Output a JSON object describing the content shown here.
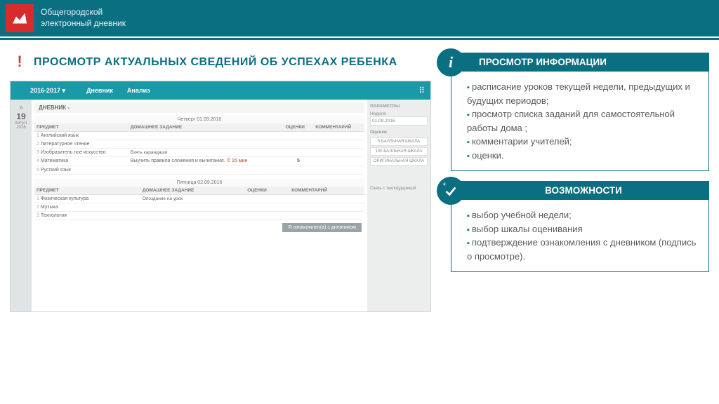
{
  "header": {
    "line1": "Общегородской",
    "line2": "электронный дневник"
  },
  "title": "ПРОСМОТР АКТУАЛЬНЫХ СВЕДЕНИЙ ОБ УСПЕХАХ РЕБЕНКА",
  "screenshot": {
    "year": "2016-2017 ▾",
    "tab1": "Дневник",
    "tab2": "Анализ",
    "dayNum": "19",
    "dayMonth": "Август",
    "dayYear": "2016",
    "diaryTitle": "ДНЕВНИК -",
    "hdr_day1": "Четверг  01.09.2016",
    "hdr_day2": "Пятница  02.09.2016",
    "col_subject": "ПРЕДМЕТ",
    "col_hw": "ДОМАШНЕЕ ЗАДАНИЕ",
    "col_marks": "ОЦЕНКИ",
    "col_comment": "КОММЕНТАРИЙ",
    "r1": "Английский язык",
    "r2": "Литературное чтение",
    "r3": "Изобразитель ное искусство",
    "r3_note": "Взять карандаши",
    "r4": "Математика",
    "r4_hw": "Выучить правила сложения и вычитания.",
    "r4_time": "⏱ 15 мин",
    "r4_mark": "5",
    "r5": "Русский язык",
    "r6": "Физическая культура",
    "r6_note": "Опоздание на урок",
    "r7": "Музыка",
    "r8": "Технология",
    "btn": "Я ознакомлен(а) с дневником",
    "side_params": "ПАРАМЕТРЫ",
    "side_week": "Неделя",
    "side_date": "01.09.2016",
    "side_marks": "Оценки",
    "scale5": "5 БАЛЛЬНАЯ ШКАЛА",
    "scale100": "100 БАЛЛЬНАЯ ШКАЛА",
    "scaleO": "ОРИГИНАЛЬНАЯ ШКАЛА",
    "support": "Связь с техподдержкой"
  },
  "panel1": {
    "title": "ПРОСМОТР ИНФОРМАЦИИ",
    "items": [
      "расписание уроков  текущей недели, предыдущих и будущих периодов;",
      "просмотр списка заданий для самостоятельной работы дома ;",
      "комментарии учителей;",
      "оценки."
    ]
  },
  "panel2": {
    "title": "ВОЗМОЖНОСТИ",
    "items": [
      "выбор учебной недели;",
      "выбор шкалы оценивания",
      "подтверждение  ознакомления с дневником (подпись о просмотре)."
    ]
  }
}
